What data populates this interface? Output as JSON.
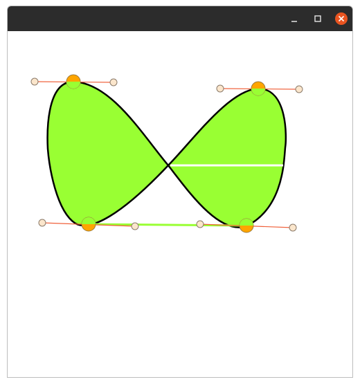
{
  "window": {
    "title": ""
  },
  "controls": {
    "minimize_icon": "minimize-icon",
    "maximize_icon": "maximize-icon",
    "close_icon": "close-icon"
  },
  "colors": {
    "titlebar": "#2c2c2c",
    "shape_fill": "#99ff33",
    "shape_stroke": "#000000",
    "anchor_fill": "#ffa500",
    "anchor_overlay": "#99ff33",
    "handle_fill": "#fbe6cc",
    "handle_line": "#f0603a",
    "segment_highlight": "#99ff33",
    "close_button": "#e95420"
  }
}
